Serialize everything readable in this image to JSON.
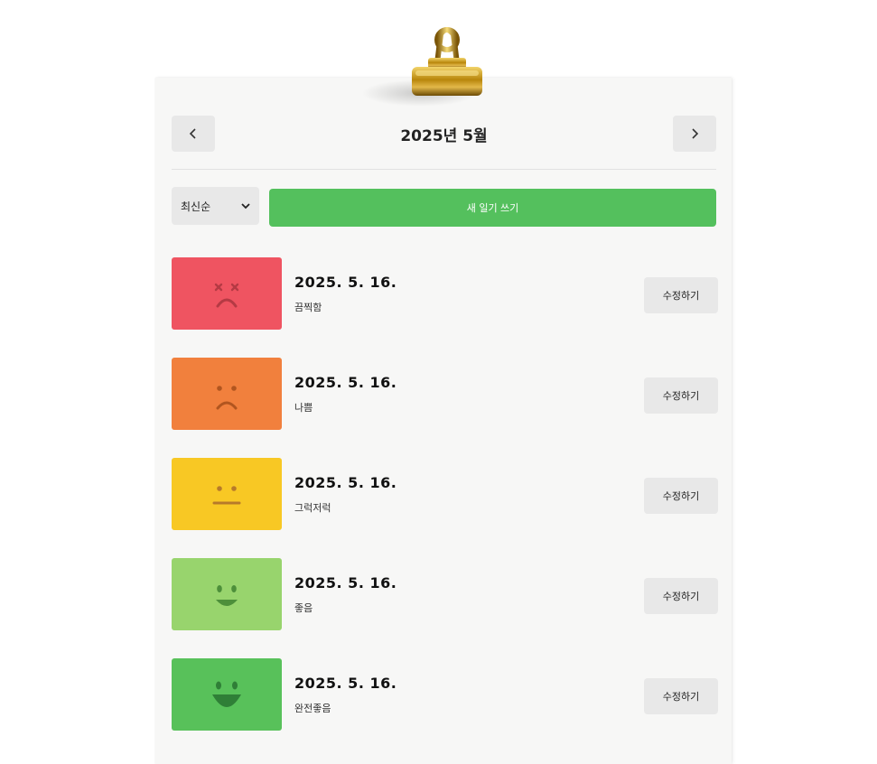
{
  "header": {
    "title": "2025년 5월",
    "prev_icon": "chevron-left-icon",
    "next_icon": "chevron-right-icon"
  },
  "toolbar": {
    "sort_selected": "최신순",
    "new_button_label": "새 일기 쓰기"
  },
  "colors": {
    "accent_green": "#54c05d",
    "button_gray": "#e8e8e8"
  },
  "entries": [
    {
      "date": "2025. 5. 16.",
      "mood": "끔찍함",
      "color": "#ef5461",
      "icon": "terrible-face-icon",
      "edit_label": "수정하기"
    },
    {
      "date": "2025. 5. 16.",
      "mood": "나쁨",
      "color": "#f1803d",
      "icon": "sad-face-icon",
      "edit_label": "수정하기"
    },
    {
      "date": "2025. 5. 16.",
      "mood": "그럭저럭",
      "color": "#f8c824",
      "icon": "neutral-face-icon",
      "edit_label": "수정하기"
    },
    {
      "date": "2025. 5. 16.",
      "mood": "좋음",
      "color": "#98d46d",
      "icon": "smile-face-icon",
      "edit_label": "수정하기"
    },
    {
      "date": "2025. 5. 16.",
      "mood": "완전좋음",
      "color": "#58c15a",
      "icon": "happy-face-icon",
      "edit_label": "수정하기"
    }
  ]
}
